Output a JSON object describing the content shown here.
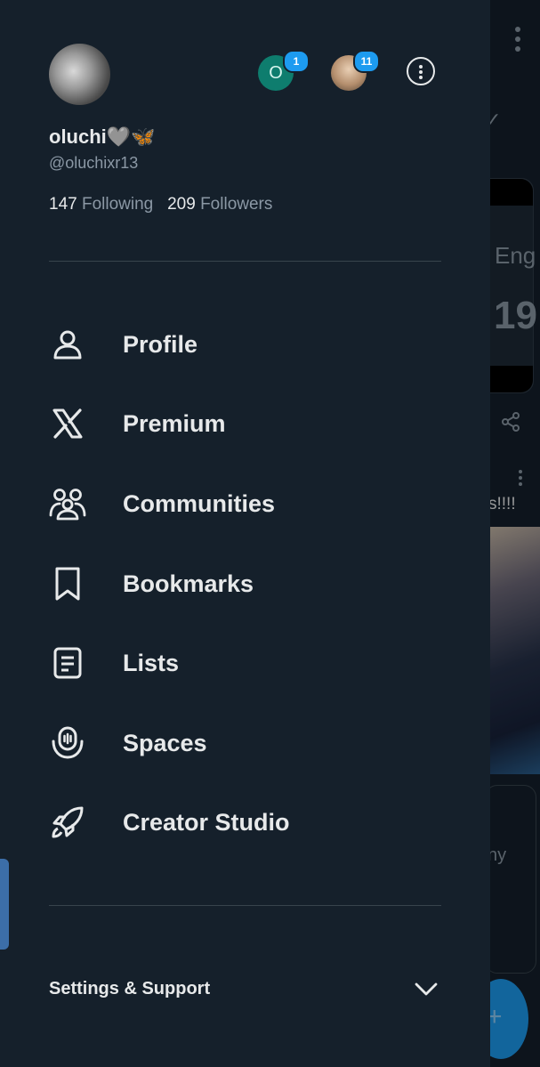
{
  "profile": {
    "display_name": "oluchi🩶🦋",
    "handle": "@oluchixr13",
    "following_count": "147",
    "following_label": "Following",
    "followers_count": "209",
    "followers_label": "Followers"
  },
  "accounts": [
    {
      "initial": "O",
      "badge": "1",
      "color": "#0e7d6e"
    },
    {
      "initial": "",
      "badge": "11"
    }
  ],
  "menu": [
    {
      "label": "Profile",
      "icon": "person-icon"
    },
    {
      "label": "Premium",
      "icon": "x-logo-icon"
    },
    {
      "label": "Communities",
      "icon": "communities-icon"
    },
    {
      "label": "Bookmarks",
      "icon": "bookmark-icon"
    },
    {
      "label": "Lists",
      "icon": "list-icon"
    },
    {
      "label": "Spaces",
      "icon": "spaces-icon"
    },
    {
      "label": "Creator Studio",
      "icon": "rocket-icon"
    }
  ],
  "settings": {
    "label": "Settings & Support"
  },
  "background": {
    "tab_text": "Eng",
    "big_number": "19",
    "post_text": "s!!!!",
    "card_text": "ny"
  },
  "colors": {
    "accent": "#1d9bf0",
    "bg": "#15202b",
    "text": "#e7e9ea",
    "muted": "#8b98a5"
  }
}
